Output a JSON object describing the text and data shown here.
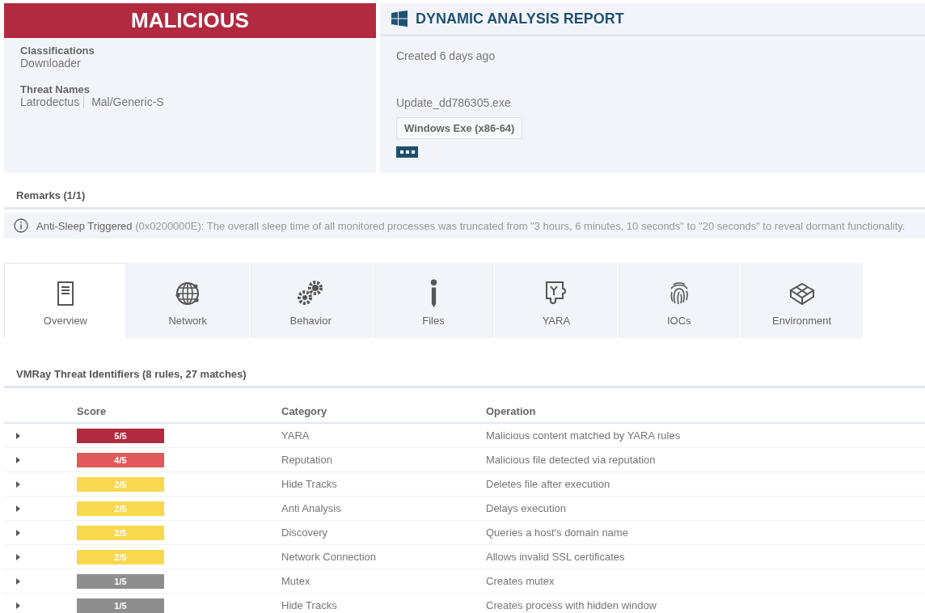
{
  "verdict": {
    "label": "MALICIOUS",
    "classifications_label": "Classifications",
    "classifications": "Downloader",
    "threat_names_label": "Threat Names",
    "threat_names": [
      "Latrodectus",
      "Mal/Generic-S"
    ]
  },
  "report": {
    "title": "DYNAMIC ANALYSIS REPORT",
    "created": "Created 6 days ago",
    "filename": "Update_dd786305.exe",
    "file_type": "Windows Exe (x86-64)"
  },
  "remarks": {
    "title": "Remarks (1/1)",
    "items": [
      {
        "title": "Anti-Sleep Triggered",
        "text": "(0x0200000E): The overall sleep time of all monitored processes was truncated from \"3 hours, 6 minutes, 10 seconds\" to \"20 seconds\" to reveal dormant functionality."
      }
    ]
  },
  "tabs": [
    {
      "label": "Overview",
      "kind": "document",
      "selected": true
    },
    {
      "label": "Network",
      "kind": "globe",
      "selected": false
    },
    {
      "label": "Behavior",
      "kind": "gears",
      "selected": false
    },
    {
      "label": "Files",
      "kind": "info",
      "selected": false
    },
    {
      "label": "YARA",
      "kind": "puzzle",
      "selected": false
    },
    {
      "label": "IOCs",
      "kind": "fingerprint",
      "selected": false
    },
    {
      "label": "Environment",
      "kind": "cube",
      "selected": false
    }
  ],
  "threat_identifiers": {
    "title": "VMRay Threat Identifiers (8 rules, 27 matches)",
    "columns": [
      "Score",
      "Category",
      "Operation"
    ],
    "rows": [
      {
        "score": "5/5",
        "color": "#b22a40",
        "category": "YARA",
        "operation": "Malicious content matched by YARA rules",
        "expanded": false
      },
      {
        "score": "4/5",
        "color": "#e05a5a",
        "category": "Reputation",
        "operation": "Malicious file detected via reputation",
        "expanded": false
      },
      {
        "score": "2/5",
        "color": "#f8d84e",
        "category": "Hide Tracks",
        "operation": "Deletes file after execution",
        "expanded": false
      },
      {
        "score": "2/5",
        "color": "#f8d84e",
        "category": "Anti Analysis",
        "operation": "Delays execution",
        "expanded": false
      },
      {
        "score": "2/5",
        "color": "#f8d84e",
        "category": "Discovery",
        "operation": "Queries a host's domain name",
        "expanded": false
      },
      {
        "score": "2/5",
        "color": "#f8d84e",
        "category": "Network Connection",
        "operation": "Allows invalid SSL certificates",
        "expanded": false
      },
      {
        "score": "1/5",
        "color": "#8e8e8e",
        "category": "Mutex",
        "operation": "Creates mutex",
        "expanded": false
      },
      {
        "score": "1/5",
        "color": "#8e8e8e",
        "category": "Hide Tracks",
        "operation": "Creates process with hidden window",
        "expanded": false
      }
    ]
  }
}
